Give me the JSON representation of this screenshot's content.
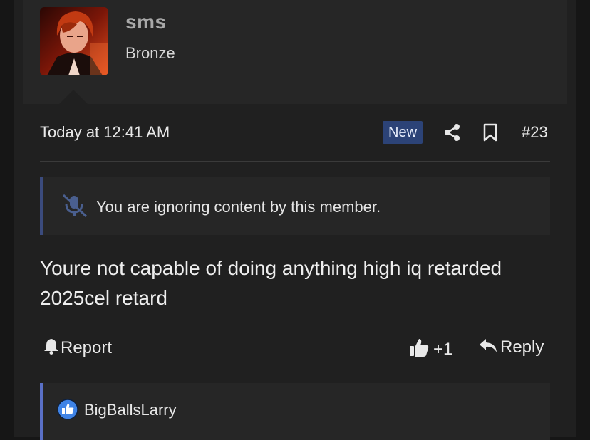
{
  "user": {
    "name": "sms",
    "title": "Bronze"
  },
  "post": {
    "date": "Today at 12:41 AM",
    "badge": "New",
    "number": "#23",
    "ignore_notice": "You are ignoring content by this member.",
    "message": "Youre not capable of doing anything high iq retarded 2025cel retard"
  },
  "actions": {
    "report_label": "Report",
    "like_count": "+1",
    "reply_label": "Reply"
  },
  "reactions": {
    "users": "BigBallsLarry"
  },
  "icons": [
    "bell-icon",
    "share-icon",
    "bookmark-icon",
    "mute-icon",
    "like-icon",
    "reply-icon",
    "reaction-like-icon"
  ],
  "colors": {
    "badge_bg": "#2c4377",
    "notice_border": "#3b4b7d",
    "reaction_border": "#5a70c6",
    "reaction_icon": "#3f83e6"
  }
}
